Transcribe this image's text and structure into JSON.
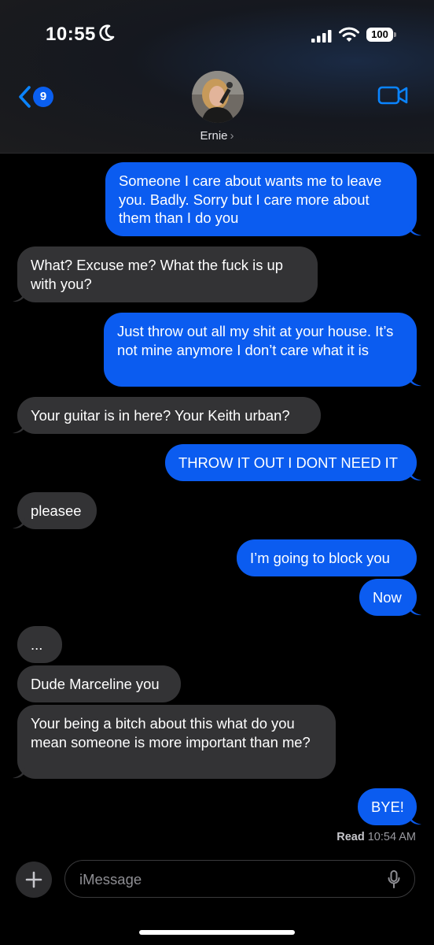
{
  "status_bar": {
    "time": "10:55",
    "battery_level": "100"
  },
  "header": {
    "back_badge_count": "9",
    "contact_name": "Ernie",
    "contact_chevron": "›",
    "icons": [
      "chevron-left-icon",
      "video-camera-icon",
      "moon-icon",
      "signal-icon",
      "wifi-icon",
      "battery-icon"
    ]
  },
  "messages": [
    {
      "direction": "sent",
      "text": "Someone I care about wants me to leave you. Badly. Sorry but I care more about them than I do you"
    },
    {
      "direction": "received",
      "text": "What? Excuse me? What the fuck is up with you?"
    },
    {
      "direction": "sent",
      "text": "Just throw out all my shit at your house. It’s not mine anymore I don’t care what it is"
    },
    {
      "direction": "received",
      "text": "Your guitar is in here? Your Keith urban?"
    },
    {
      "direction": "sent",
      "text": "THROW IT OUT I DONT NEED IT"
    },
    {
      "direction": "received",
      "text": "pleasee"
    },
    {
      "direction": "sent",
      "text": "I’m going to block you"
    },
    {
      "direction": "sent",
      "text": "Now"
    },
    {
      "direction": "received",
      "text": "..."
    },
    {
      "direction": "received",
      "text": "Dude Marceline you"
    },
    {
      "direction": "received",
      "text": "Your being a bitch about this what do you mean someone is more important than me?"
    },
    {
      "direction": "sent",
      "text": "BYE!"
    }
  ],
  "read_receipt": {
    "label": "Read",
    "time": "10:54 AM"
  },
  "composer": {
    "placeholder": "iMessage",
    "icons": [
      "plus-icon",
      "microphone-icon"
    ]
  },
  "colors": {
    "sent_bubble": "#0b5cf0",
    "received_bubble": "#333335",
    "accent": "#0a84ff",
    "background": "#000000"
  }
}
